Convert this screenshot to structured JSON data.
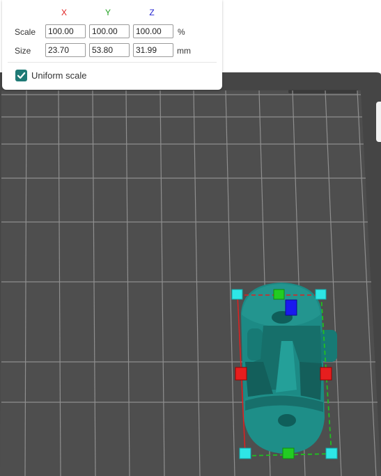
{
  "scale_panel": {
    "axis_x": "X",
    "axis_y": "Y",
    "axis_z": "Z",
    "scale_label": "Scale",
    "size_label": "Size",
    "scale_x": "100.00",
    "scale_y": "100.00",
    "scale_z": "100.00",
    "scale_unit": "%",
    "size_x": "23.70",
    "size_y": "53.80",
    "size_z": "31.99",
    "size_unit": "mm",
    "uniform_scale_label": "Uniform scale",
    "uniform_scale_checked": true
  },
  "colors": {
    "axis_x": "#e02020",
    "axis_y": "#20a020",
    "axis_z": "#2020d0",
    "model": "#1c8a85",
    "build_plate": "#4e4e4e",
    "grid": "#8f8f8f",
    "accent": "#1f7a76"
  }
}
